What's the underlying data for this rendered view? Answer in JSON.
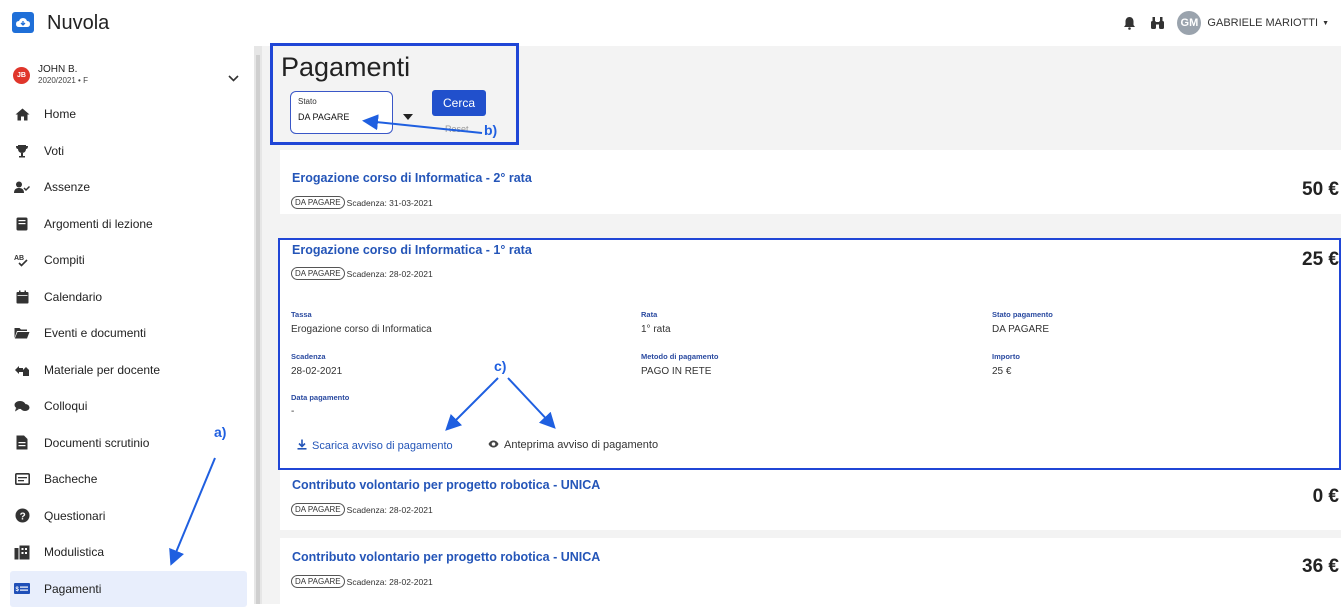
{
  "app": {
    "title": "Nuvola"
  },
  "header": {
    "user_initials": "GM",
    "user_name": "GABRIELE MARIOTTI"
  },
  "student": {
    "initials": "JB",
    "name": "JOHN B.",
    "sub": "2020/2021 • F"
  },
  "sidebar": {
    "items": [
      {
        "label": "Home",
        "icon": "home-icon"
      },
      {
        "label": "Voti",
        "icon": "trophy-icon"
      },
      {
        "label": "Assenze",
        "icon": "person-check-icon"
      },
      {
        "label": "Argomenti di lezione",
        "icon": "book-icon"
      },
      {
        "label": "Compiti",
        "icon": "spellcheck-icon"
      },
      {
        "label": "Calendario",
        "icon": "calendar-icon"
      },
      {
        "label": "Eventi e documenti",
        "icon": "folder-open-icon"
      },
      {
        "label": "Materiale per docente",
        "icon": "share-icon"
      },
      {
        "label": "Colloqui",
        "icon": "chat-icon"
      },
      {
        "label": "Documenti scrutinio",
        "icon": "document-icon"
      },
      {
        "label": "Bacheche",
        "icon": "board-icon"
      },
      {
        "label": "Questionari",
        "icon": "help-icon"
      },
      {
        "label": "Modulistica",
        "icon": "forms-icon"
      },
      {
        "label": "Pagamenti",
        "icon": "payment-icon"
      }
    ]
  },
  "main": {
    "title": "Pagamenti",
    "filter": {
      "label": "Stato",
      "value": "DA PAGARE",
      "search_label": "Cerca",
      "reset_label": "Reset"
    },
    "payments": [
      {
        "title": "Erogazione corso di Informatica - 2° rata",
        "status": "DA PAGARE",
        "due": "Scadenza: 31-03-2021",
        "amount": "50 €"
      },
      {
        "title": "Erogazione corso di Informatica - 1° rata",
        "status": "DA PAGARE",
        "due": "Scadenza: 28-02-2021",
        "amount": "25 €"
      },
      {
        "title": "Contributo volontario per progetto robotica - UNICA",
        "status": "DA PAGARE",
        "due": "Scadenza: 28-02-2021",
        "amount": "0 €"
      },
      {
        "title": "Contributo volontario per progetto robotica - UNICA",
        "status": "DA PAGARE",
        "due": "Scadenza: 28-02-2021",
        "amount": "36 €"
      }
    ],
    "details": {
      "tassa_label": "Tassa",
      "tassa_value": "Erogazione corso di Informatica",
      "rata_label": "Rata",
      "rata_value": "1° rata",
      "stato_label": "Stato pagamento",
      "stato_value": "DA PAGARE",
      "scadenza_label": "Scadenza",
      "scadenza_value": "28-02-2021",
      "metodo_label": "Metodo di pagamento",
      "metodo_value": "PAGO IN RETE",
      "importo_label": "Importo",
      "importo_value": "25 €",
      "data_label": "Data pagamento",
      "data_value": "-",
      "download_label": "Scarica avviso di pagamento",
      "preview_label": "Anteprima avviso di pagamento"
    }
  },
  "annotations": {
    "a": "a)",
    "b": "b)",
    "c": "c)"
  },
  "colors": {
    "accent": "#2150cc",
    "annotation": "#1f5fe0",
    "link": "#2455b8"
  }
}
